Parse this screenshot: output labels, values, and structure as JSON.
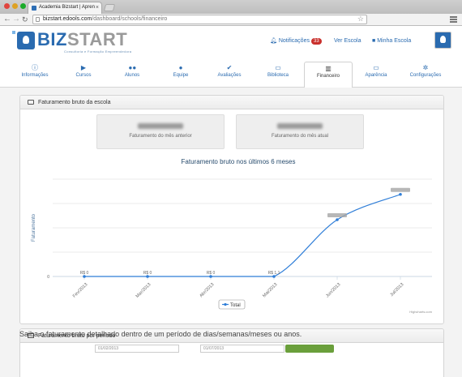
{
  "browser": {
    "tab_title": "Academia Bizstart | Apren",
    "url_host": "bizstart.edools.com",
    "url_path": "/dashboard/schools/financeiro"
  },
  "header": {
    "logo_text_a": "BIZ",
    "logo_text_b": "START",
    "logo_tagline": "Consultoria e Formação Empreendedora",
    "links": {
      "notifications": "Notificações",
      "notifications_count": "33",
      "view_school": "Ver Escola",
      "my_school": "Minha Escola"
    }
  },
  "tabs": [
    {
      "label": "Informações",
      "icon": "info-icon"
    },
    {
      "label": "Cursos",
      "icon": "play-icon"
    },
    {
      "label": "Alunos",
      "icon": "users-icon"
    },
    {
      "label": "Equipe",
      "icon": "user-icon"
    },
    {
      "label": "Avaliações",
      "icon": "check-icon"
    },
    {
      "label": "Biblioteca",
      "icon": "inbox-icon"
    },
    {
      "label": "Financeiro",
      "icon": "chart-icon",
      "active": true
    },
    {
      "label": "Aparência",
      "icon": "monitor-icon"
    },
    {
      "label": "Configurações",
      "icon": "cogs-icon"
    }
  ],
  "panel1": {
    "title": "Faturamento bruto da escola",
    "stats": [
      {
        "label": "Faturamento do mês anterior"
      },
      {
        "label": "Faturamento do mês atual"
      }
    ]
  },
  "chart_data": {
    "type": "line",
    "title": "Faturamento bruto nos últimos 6 meses",
    "ylabel": "Faturamento",
    "categories": [
      "Fev/2013",
      "Mar/2013",
      "Abr/2013",
      "Mai/2013",
      "Jun/2013",
      "Jul/2013"
    ],
    "series": [
      {
        "name": "Total",
        "values": [
          0,
          0,
          0,
          0,
          2.8,
          4.05
        ]
      }
    ],
    "ylim": [
      0,
      4.8
    ],
    "yticks": [
      0
    ],
    "y_tick_label": "0",
    "data_labels": [
      "R$ 0",
      "R$ 0",
      "R$ 0",
      "R$ 1,1"
    ],
    "grid": true,
    "legend": "bottom-center",
    "credit": "Highcharts.com",
    "color": "#2f7ed8"
  },
  "panel2": {
    "title": "Faturamento bruto por período",
    "subtitle": "Saiba o faturamento detalhado dentro de um período de dias/semanas/meses ou anos.",
    "input_from": "01/02/2013",
    "input_to": "01/07/2013"
  }
}
